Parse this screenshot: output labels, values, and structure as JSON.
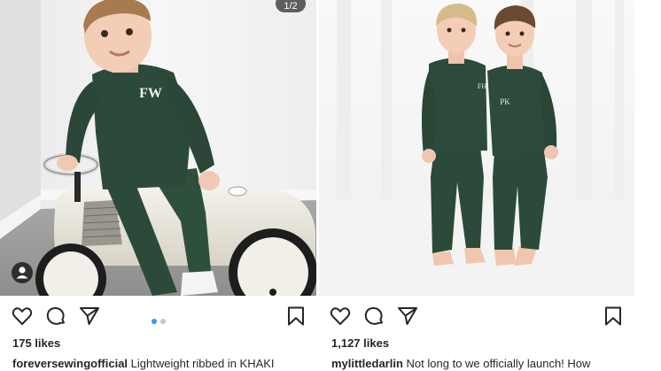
{
  "posts": [
    {
      "photo": {
        "description_icon": "photo"
      },
      "carousel_counter": "1/2",
      "carousel_dots": 2,
      "carousel_active_index": 0,
      "likes": "175 likes",
      "username": "foreversewingofficial",
      "caption": "Lightweight ribbed in KHAKI",
      "monogram": "FW"
    },
    {
      "likes": "1,127 likes",
      "username": "mylittledarlin",
      "caption": "Not long to we officially launch! How",
      "monogram_left": "FH",
      "monogram_right": "PK"
    }
  ],
  "icons": {
    "like": "heart-icon",
    "comment": "comment-icon",
    "share": "paper-plane-icon",
    "save": "bookmark-icon",
    "tags": "user-tag-icon"
  },
  "colors": {
    "accent": "#3897f0",
    "text": "#262626",
    "outfit_green": "#2c4a39"
  }
}
